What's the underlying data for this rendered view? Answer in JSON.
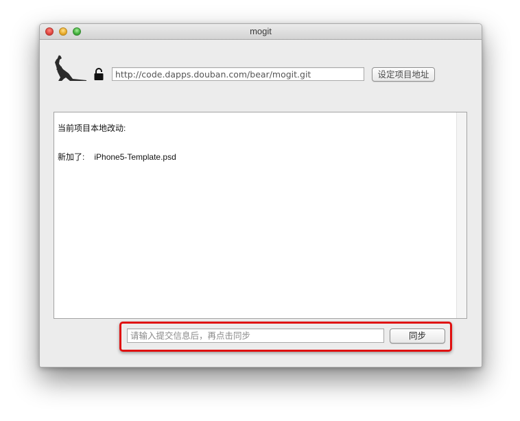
{
  "window": {
    "title": "mogit"
  },
  "toolbar": {
    "logo_icon": "kangaroo-logo-icon",
    "lock_icon": "lock-icon",
    "repo_url_value": "http://code.dapps.douban.com/bear/mogit.git",
    "set_url_label": "设定项目地址"
  },
  "changes": {
    "heading": "当前项目本地改动:",
    "items": [
      {
        "status": "新加了:",
        "file": "iPhone5-Template.psd"
      }
    ]
  },
  "commit": {
    "placeholder": "请输入提交信息后，再点击同步",
    "value": "",
    "sync_label": "同步",
    "highlight_color": "#e01010"
  }
}
